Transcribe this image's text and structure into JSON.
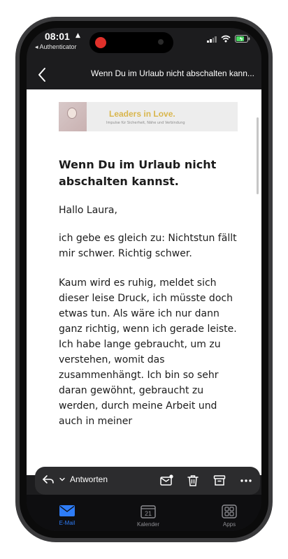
{
  "status_bar": {
    "time": "08:01",
    "back_app": "◂ Authenticator"
  },
  "header": {
    "title": "Wenn Du im Urlaub nicht abschalten kann..."
  },
  "banner": {
    "title": "Leaders in Love.",
    "subtitle": "Impulse für Sicherheit, Nähe und Verbindung"
  },
  "article": {
    "heading": "Wenn Du im Urlaub nicht abschalten kannst.",
    "greeting": "Hallo Laura,",
    "paragraph_1": "ich gebe es gleich zu: Nichtstun fällt mir schwer. Richtig schwer.",
    "paragraph_2": "Kaum wird es ruhig, meldet sich dieser leise Druck, ich müsste doch etwas tun. Als wäre ich nur dann ganz richtig, wenn ich gerade leiste. Ich habe lange gebraucht, um zu verstehen, womit das zusammenhängt. Ich bin so sehr daran gewöhnt, gebraucht zu werden, durch meine Arbeit und auch in meiner"
  },
  "action_bar": {
    "reply_label": "Antworten"
  },
  "tabs": [
    {
      "label": "E-Mail",
      "active": true
    },
    {
      "label": "Kalender",
      "active": false
    },
    {
      "label": "Apps",
      "active": false
    }
  ],
  "calendar_day": "21",
  "colors": {
    "accent": "#2e7cf6",
    "banner_gold": "#d9b64d",
    "recording": "#e0302a",
    "battery": "#4cd964"
  }
}
